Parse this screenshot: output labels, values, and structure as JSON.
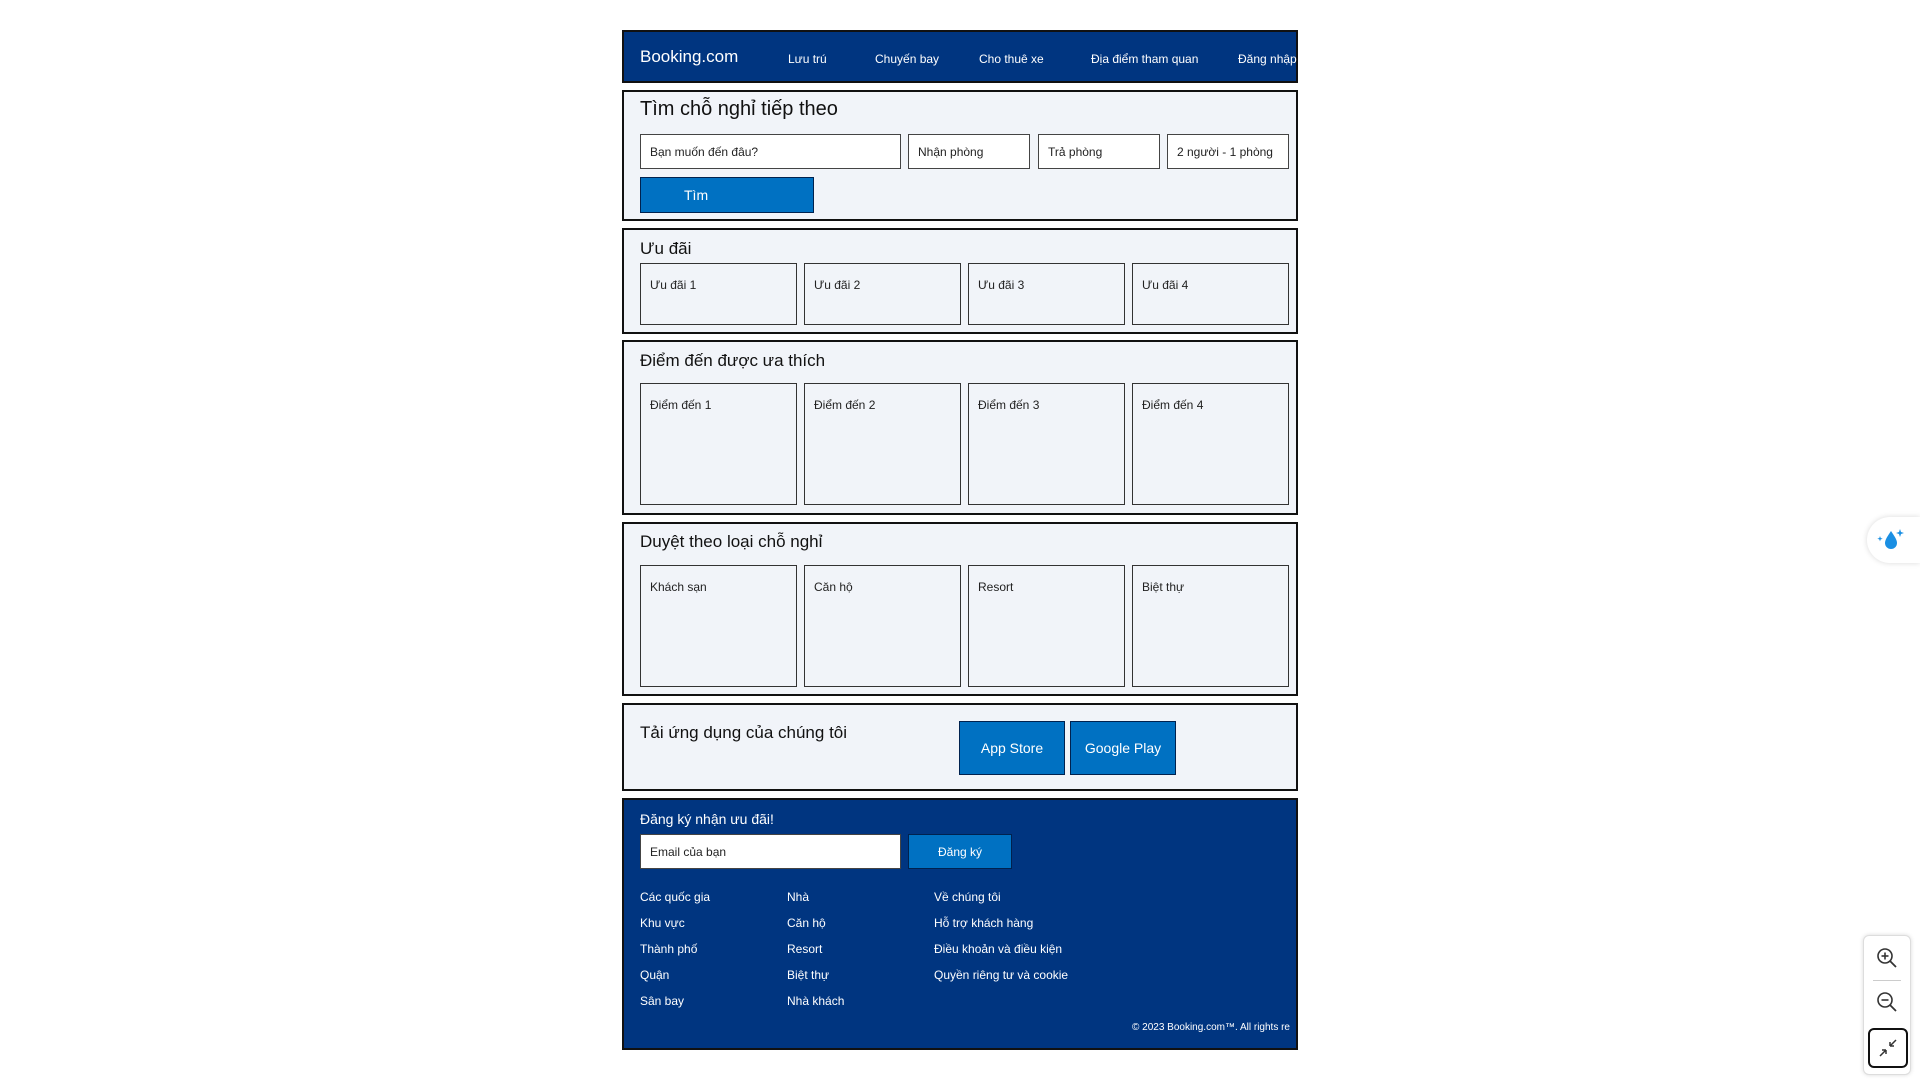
{
  "header": {
    "logo": "Booking.com",
    "nav": [
      "Lưu trú",
      "Chuyến bay",
      "Cho thuê xe",
      "Địa điểm tham quan",
      "Đăng nhập"
    ]
  },
  "search": {
    "title": "Tìm chỗ nghỉ tiếp theo",
    "destination_placeholder": "Bạn muốn đến đâu?",
    "checkin_placeholder": "Nhận phòng",
    "checkout_placeholder": "Trả phòng",
    "guests": "2 người - 1 phòng",
    "button": "Tìm"
  },
  "deals": {
    "title": "Ưu đãi",
    "items": [
      "Ưu đãi 1",
      "Ưu đãi 2",
      "Ưu đãi 3",
      "Ưu đãi 4"
    ]
  },
  "destinations": {
    "title": "Điểm đến được ưa thích",
    "items": [
      "Điểm đến 1",
      "Điểm đến 2",
      "Điểm đến 3",
      "Điểm đến 4"
    ]
  },
  "property_types": {
    "title": "Duyệt theo loại chỗ nghỉ",
    "items": [
      "Khách sạn",
      "Căn hộ",
      "Resort",
      "Biệt thự"
    ]
  },
  "app": {
    "title": "Tải ứng dụng của chúng tôi",
    "app_store": "App Store",
    "google_play": "Google Play"
  },
  "footer": {
    "newsletter_title": "Đăng ký nhận ưu đãi!",
    "email_placeholder": "Email của bạn",
    "subscribe_button": "Đăng ký",
    "col1": [
      "Các quốc gia",
      "Khu vực",
      "Thành phố",
      "Quận",
      "Sân bay"
    ],
    "col2": [
      "Nhà",
      "Căn hộ",
      "Resort",
      "Biệt thự",
      "Nhà khách"
    ],
    "col3": [
      "Về chúng tôi",
      "Hỗ trợ khách hàng",
      "Điều khoản và điều kiện",
      "Quyền riêng tư và cookie"
    ],
    "copyright": "© 2023 Booking.com™. All rights re"
  },
  "viewer": {
    "icons": [
      "zoom-in-icon",
      "zoom-out-icon",
      "fit-to-screen-icon",
      "ai-sparkle-droplet-icon"
    ]
  },
  "colors": {
    "brand_dark_blue": "#003580",
    "button_blue": "#0071c2",
    "panel_bg": "#f1f4f9"
  }
}
